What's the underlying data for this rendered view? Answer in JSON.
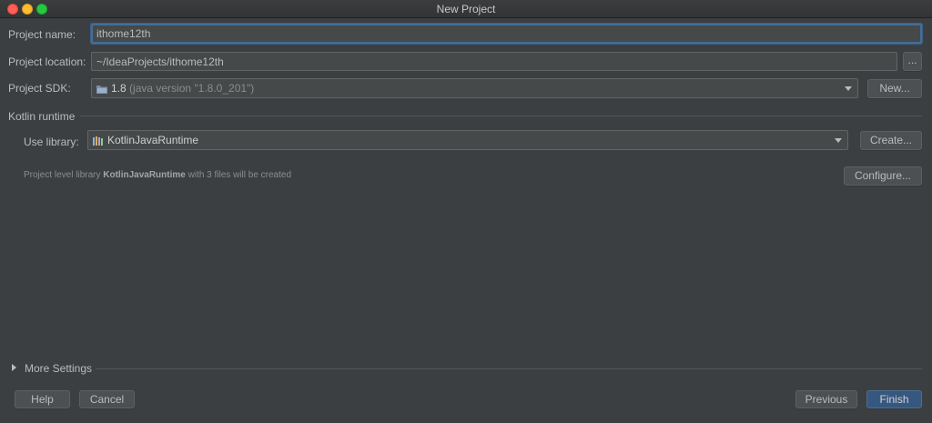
{
  "window": {
    "title": "New Project"
  },
  "form": {
    "project_name_label": "Project name:",
    "project_name_value": "ithome12th",
    "project_location_label": "Project location:",
    "project_location_value": "~/IdeaProjects/ithome12th",
    "browse_label": "...",
    "project_sdk_label": "Project SDK:",
    "sdk_version": "1.8",
    "sdk_detail": "(java version \"1.8.0_201\")",
    "new_sdk_label": "New..."
  },
  "kotlin": {
    "section_title": "Kotlin runtime",
    "use_library_label": "Use library:",
    "library_value": "KotlinJavaRuntime",
    "create_label": "Create...",
    "hint_prefix": "Project level library",
    "hint_library": "KotlinJavaRuntime",
    "hint_suffix": "with 3 files will be created",
    "configure_label": "Configure..."
  },
  "more_settings": {
    "label": "More Settings"
  },
  "footer": {
    "help_label": "Help",
    "cancel_label": "Cancel",
    "previous_label": "Previous",
    "finish_label": "Finish"
  },
  "icons": {
    "close": "traffic-light-close",
    "minimize": "traffic-light-minimize",
    "maximize": "traffic-light-maximize",
    "sdk": "folder-sdk-icon",
    "library": "library-icon",
    "dropdown": "chevron-down-icon",
    "expand": "triangle-right-icon"
  },
  "colors": {
    "background": "#3c3f41",
    "field": "#45494a",
    "focus": "#466d94",
    "primary_button": "#365880"
  }
}
